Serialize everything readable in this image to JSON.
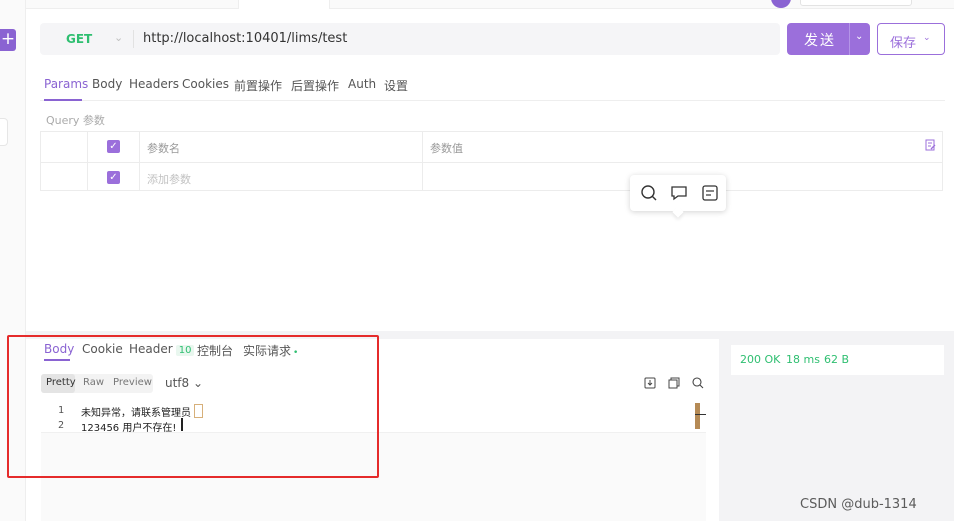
{
  "sidebar": {
    "add_label": "+"
  },
  "request": {
    "method": "GET",
    "method_chevron": "⌄",
    "url": "http://localhost:10401/lims/test",
    "send_label": "发送",
    "send_chevron": "⌄",
    "save_label": "保存",
    "save_chevron": "⌄"
  },
  "request_tabs": [
    "Params",
    "Body",
    "Headers",
    "Cookies",
    "前置操作",
    "后置操作",
    "Auth",
    "设置"
  ],
  "params": {
    "section_title": "Query 参数",
    "header_name": "参数名",
    "header_value": "参数值",
    "add_placeholder": "添加参数"
  },
  "response": {
    "tabs": {
      "body": "Body",
      "cookie": "Cookie",
      "header": "Header",
      "header_count": "10",
      "console": "控制台",
      "actual_request": "实际请求",
      "actual_dot": "•"
    },
    "formats": {
      "pretty": "Pretty",
      "raw": "Raw",
      "preview": "Preview"
    },
    "encoding": "utf8 ⌄",
    "lines": [
      {
        "num": "1",
        "text": "未知异常，请联系管理员"
      },
      {
        "num": "2",
        "text": "123456 用户不存在!"
      }
    ]
  },
  "status": {
    "code": "200 OK",
    "time": "18 ms",
    "size": "62 B"
  },
  "watermark": "CSDN @dub-1314",
  "colors": {
    "accent": "#8a63d2",
    "success": "#2fbf71",
    "highlight_box": "#e52b2b"
  }
}
